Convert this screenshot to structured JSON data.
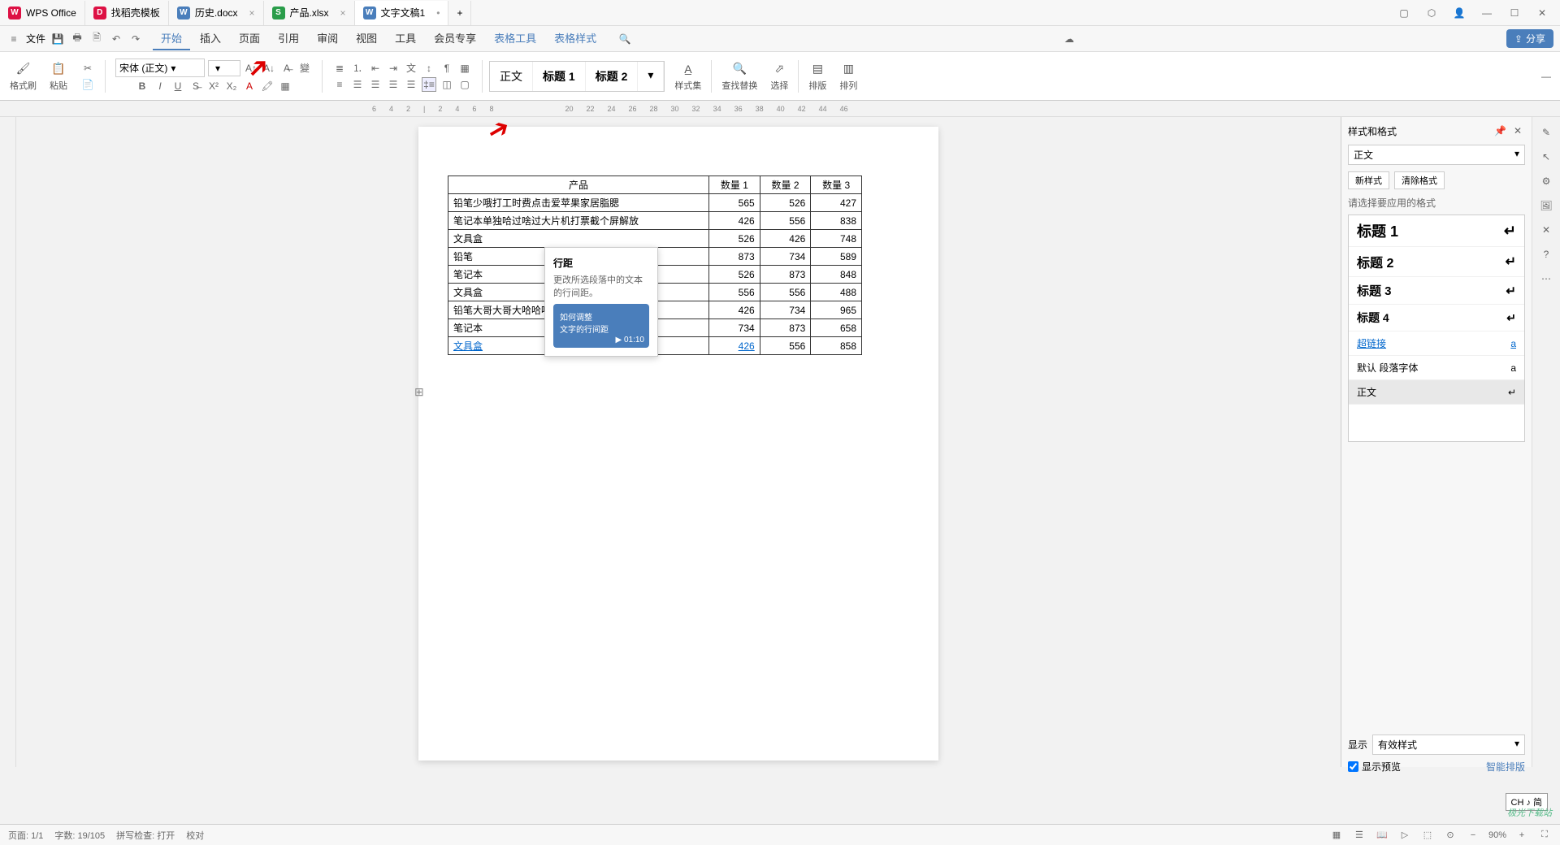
{
  "app": {
    "name": "WPS Office"
  },
  "tabs": [
    {
      "label": "找稻壳模板",
      "kind": "D",
      "color": "#d14"
    },
    {
      "label": "历史.docx",
      "kind": "W",
      "color": "#4a7ebb"
    },
    {
      "label": "产品.xlsx",
      "kind": "S",
      "color": "#2a9d4a"
    },
    {
      "label": "文字文稿1",
      "kind": "W",
      "color": "#4a7ebb",
      "active": true
    }
  ],
  "file_menu": "文件",
  "menu": [
    "开始",
    "插入",
    "页面",
    "引用",
    "审阅",
    "视图",
    "工具",
    "会员专享",
    "表格工具",
    "表格样式"
  ],
  "share": "分享",
  "ribbon": {
    "format_painter": "格式刷",
    "paste": "粘贴",
    "font": "宋体 (正文)",
    "styles_btn": "样式集",
    "find": "查找替换",
    "select": "选择",
    "layout": "排版",
    "arrange": "排列",
    "gallery": [
      "正文",
      "标题 1",
      "标题 2"
    ]
  },
  "tooltip": {
    "title": "行距",
    "desc": "更改所选段落中的文本的行间距。",
    "thumb1": "如何调整",
    "thumb2": "文字的行间距",
    "time": "01:10"
  },
  "table": {
    "headers": [
      "产品",
      "数量 1",
      "数量 2",
      "数量 3"
    ],
    "rows": [
      [
        "铅笔少哦打工时费点击爱苹果家居脂腮",
        "565",
        "526",
        "427"
      ],
      [
        "笔记本单独哈过啥过大片机打票截个屏解放",
        "426",
        "556",
        "838"
      ],
      [
        "文具盒",
        "526",
        "426",
        "748"
      ],
      [
        "铅笔",
        "873",
        "734",
        "589"
      ],
      [
        "笔记本",
        "526",
        "873",
        "848"
      ],
      [
        "文具盒",
        "556",
        "556",
        "488"
      ],
      [
        "铅笔大哥大哥大哈哈喝听觉话个",
        "426",
        "734",
        "965"
      ],
      [
        "笔记本",
        "734",
        "873",
        "658"
      ],
      [
        "文具盒",
        "426",
        "556",
        "858"
      ]
    ]
  },
  "side": {
    "title": "样式和格式",
    "current": "正文",
    "new_style": "新样式",
    "clear": "清除格式",
    "prompt": "请选择要应用的格式",
    "items": [
      "标题 1",
      "标题 2",
      "标题 3",
      "标题 4",
      "超链接",
      "默认 段落字体",
      "正文"
    ],
    "show_label": "显示",
    "show_value": "有效样式",
    "preview": "显示预览",
    "smart": "智能排版"
  },
  "status": {
    "page": "页面: 1/1",
    "words": "字数: 19/105",
    "spell": "拼写检查: 打开",
    "proof": "校对",
    "zoom": "90%"
  },
  "ime": "CH ♪ 简",
  "watermark": "极光下载站"
}
